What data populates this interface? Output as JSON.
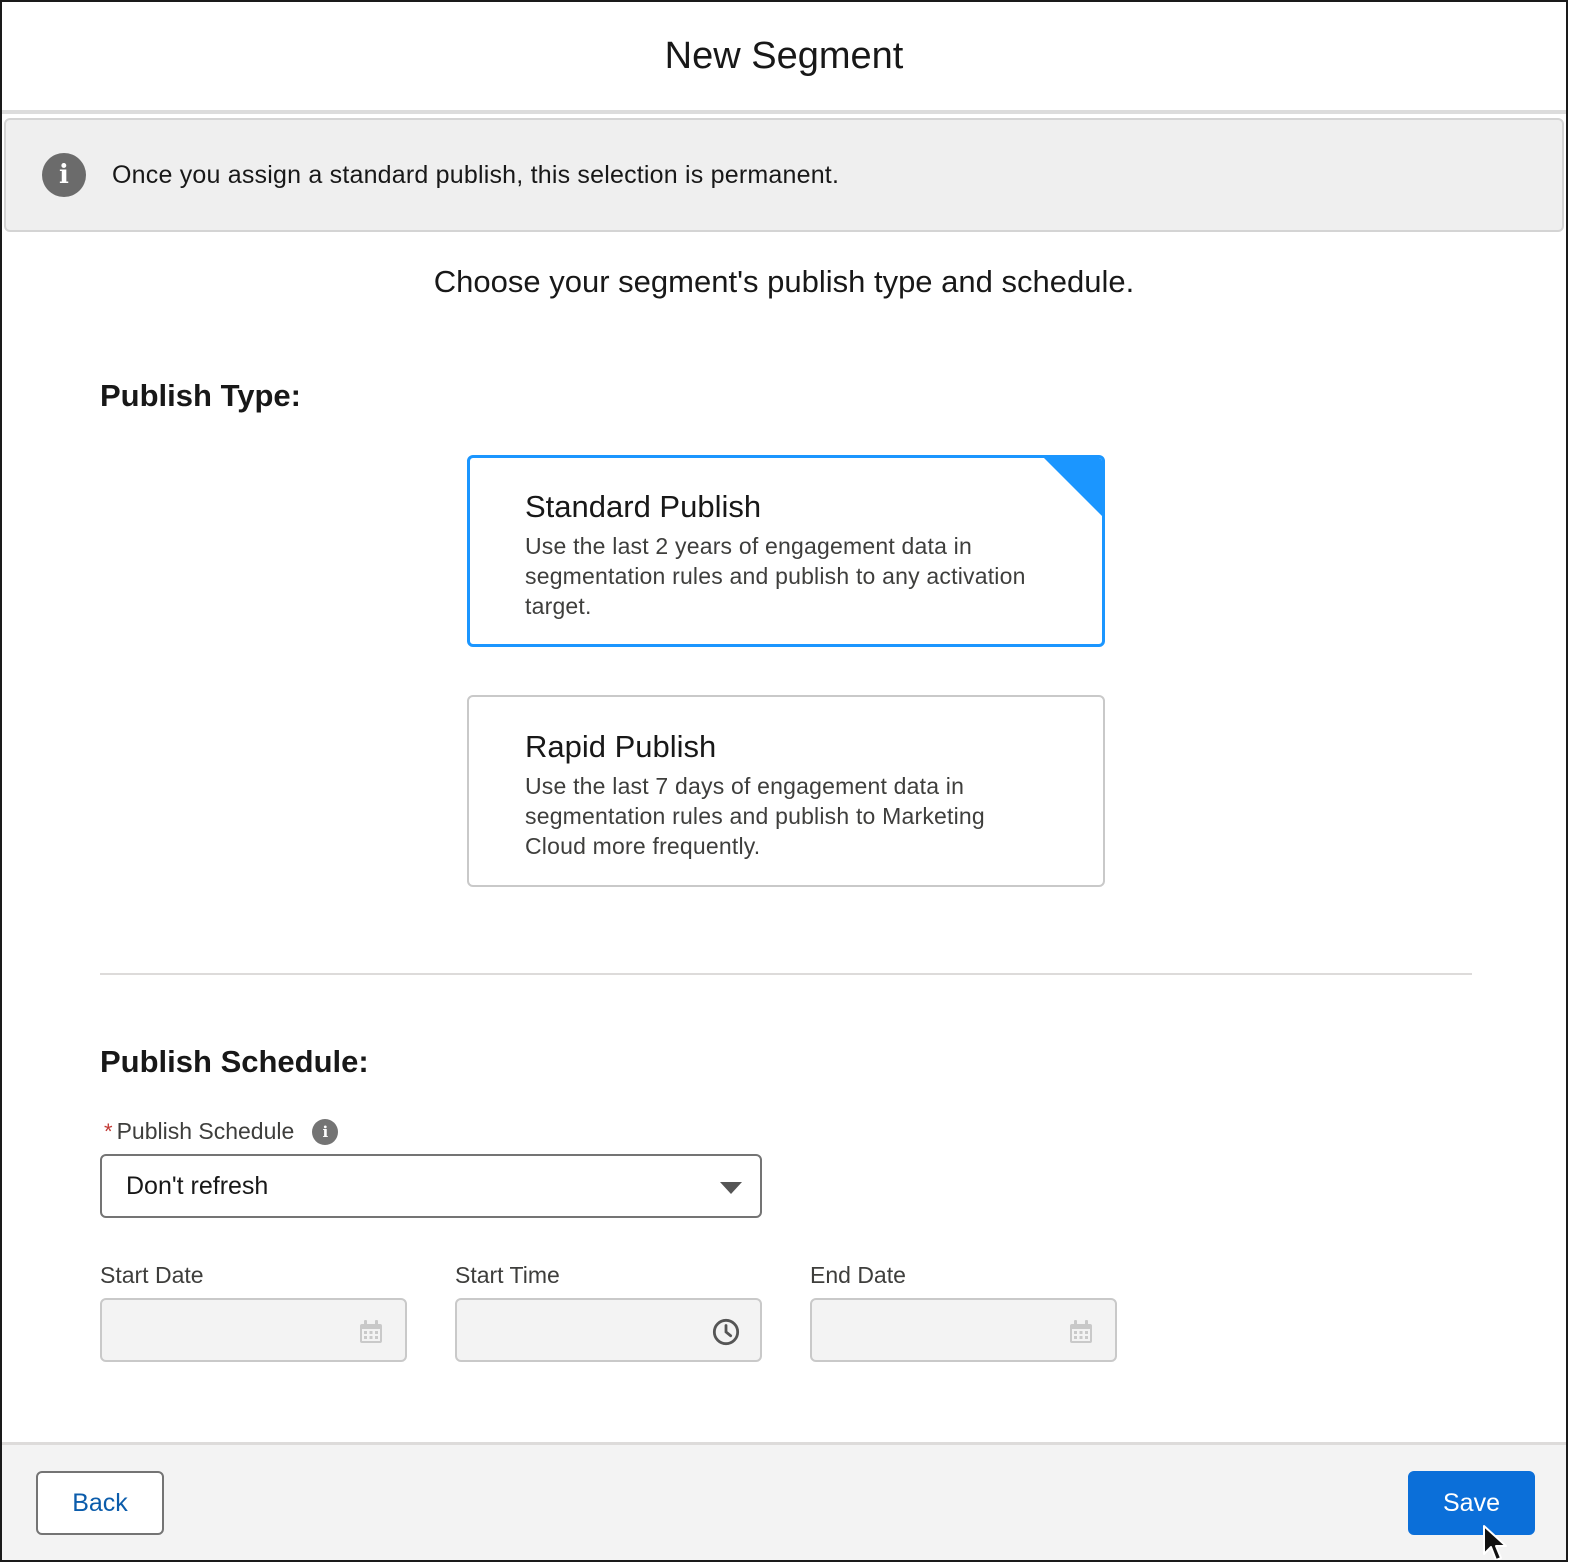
{
  "modal": {
    "title": "New Segment"
  },
  "notice": {
    "icon": "info-icon",
    "text": "Once you assign a standard publish, this selection is permanent."
  },
  "subtitle": "Choose your segment's publish type and schedule.",
  "publish_type": {
    "heading": "Publish Type:",
    "selected": "Standard Publish",
    "options": [
      {
        "title": "Standard Publish",
        "description": "Use the last 2 years of engagement data in segmentation rules and publish to any activation target."
      },
      {
        "title": "Rapid Publish",
        "description": "Use the last 7 days of engagement data in segmentation rules and publish to Marketing Cloud more frequently."
      }
    ]
  },
  "publish_schedule": {
    "heading": "Publish Schedule:",
    "field_label": "Publish Schedule",
    "required_marker": "*",
    "selected_value": "Don't refresh",
    "start_date_label": "Start Date",
    "start_time_label": "Start Time",
    "end_date_label": "End Date",
    "start_date_value": "",
    "start_time_value": "",
    "end_date_value": ""
  },
  "footer": {
    "back_label": "Back",
    "save_label": "Save"
  },
  "colors": {
    "accent": "#1b96ff",
    "brand_button": "#0b6fd9",
    "required": "#c23934"
  }
}
